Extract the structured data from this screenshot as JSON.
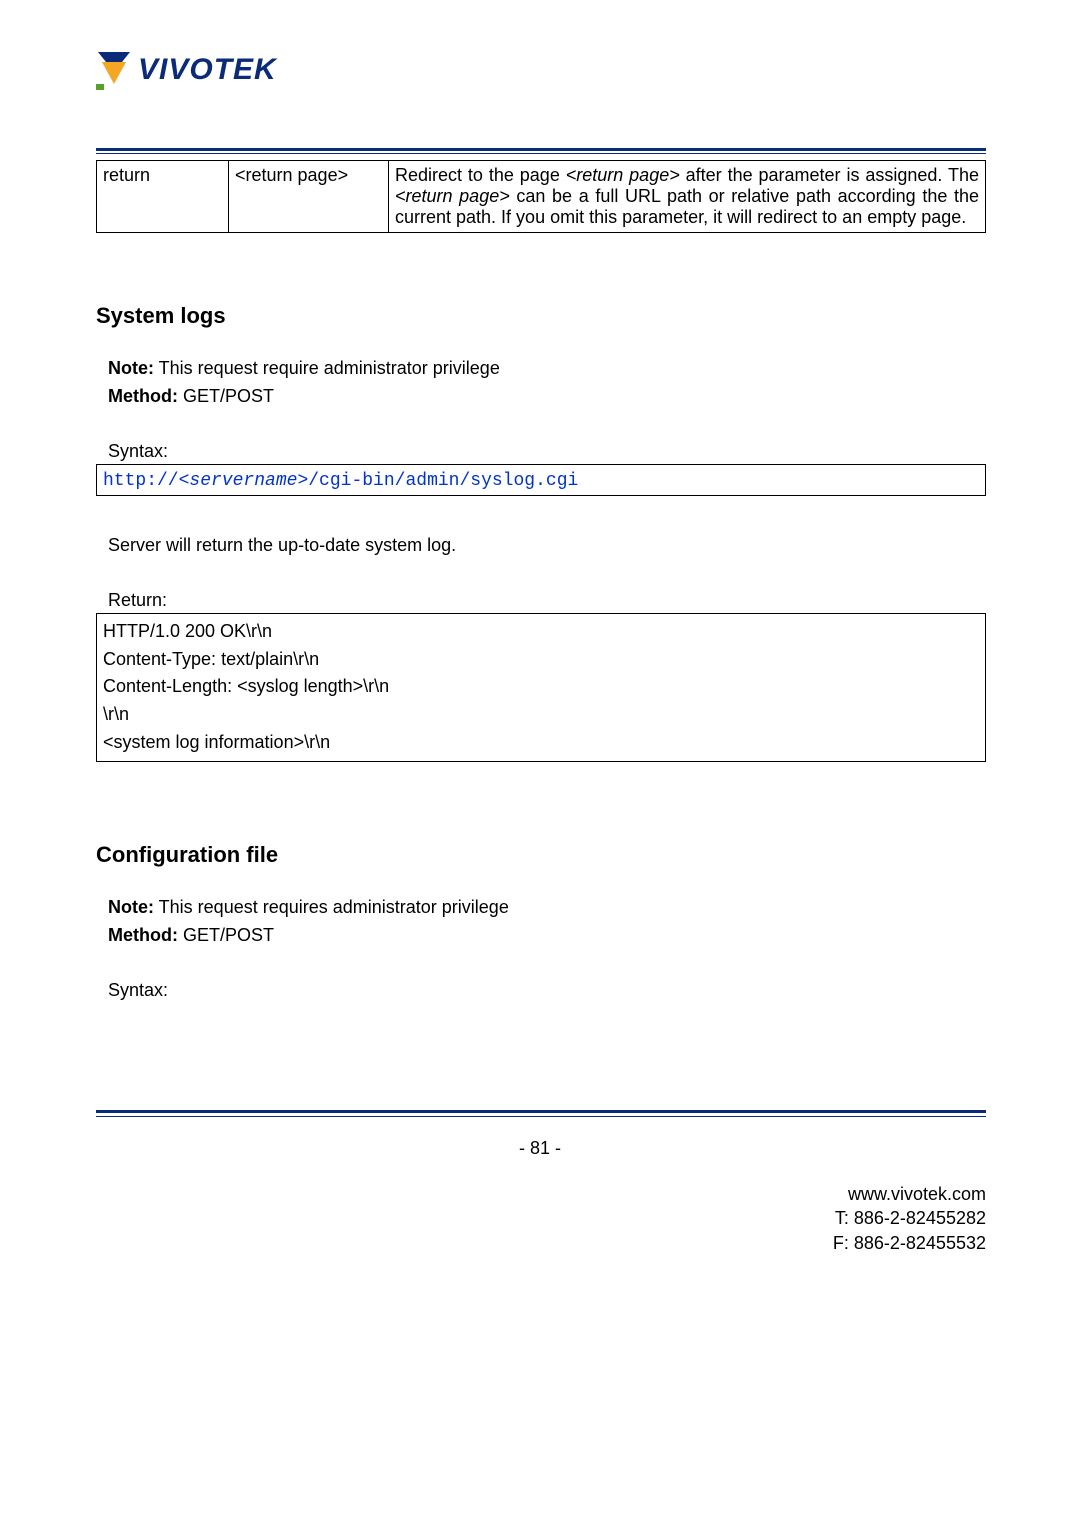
{
  "logo": {
    "text": "VIVOTEK"
  },
  "table": {
    "row": {
      "c1": "return",
      "c2": "<return page>",
      "c3_a": "Redirect to the page ",
      "c3_b": "<return page>",
      "c3_c": " after the parameter is assigned. The ",
      "c3_d": "<return page>",
      "c3_e": " can be a full URL path or relative path according the the current path. If you omit this parameter, it will redirect to an empty page."
    }
  },
  "section1": {
    "title": "System logs",
    "note_label": "Note:",
    "note_text": " This request require administrator privilege",
    "method_label": "Method:",
    "method_text": " GET/POST",
    "syntax_label": "Syntax:",
    "url_a": "http://",
    "url_b": "<servername>",
    "url_c": "/cgi-bin/admin/syslog.cgi",
    "desc": "Server will return the up-to-date system log.",
    "return_label": "Return:",
    "ret_l1": "HTTP/1.0 200 OK\\r\\n",
    "ret_l2": "Content-Type: text/plain\\r\\n",
    "ret_l3": "Content-Length: <syslog length>\\r\\n",
    "ret_l4": "\\r\\n",
    "ret_l5": "<system log information>\\r\\n"
  },
  "section2": {
    "title": "Configuration file",
    "note_label": "Note:",
    "note_text": " This request requires administrator privilege",
    "method_label": "Method:",
    "method_text": " GET/POST",
    "syntax_label": "Syntax:"
  },
  "pagenum": "- 81 -",
  "footer": {
    "url": "www.vivotek.com",
    "tel": "T: 886-2-82455282",
    "fax": "F: 886-2-82455532"
  }
}
